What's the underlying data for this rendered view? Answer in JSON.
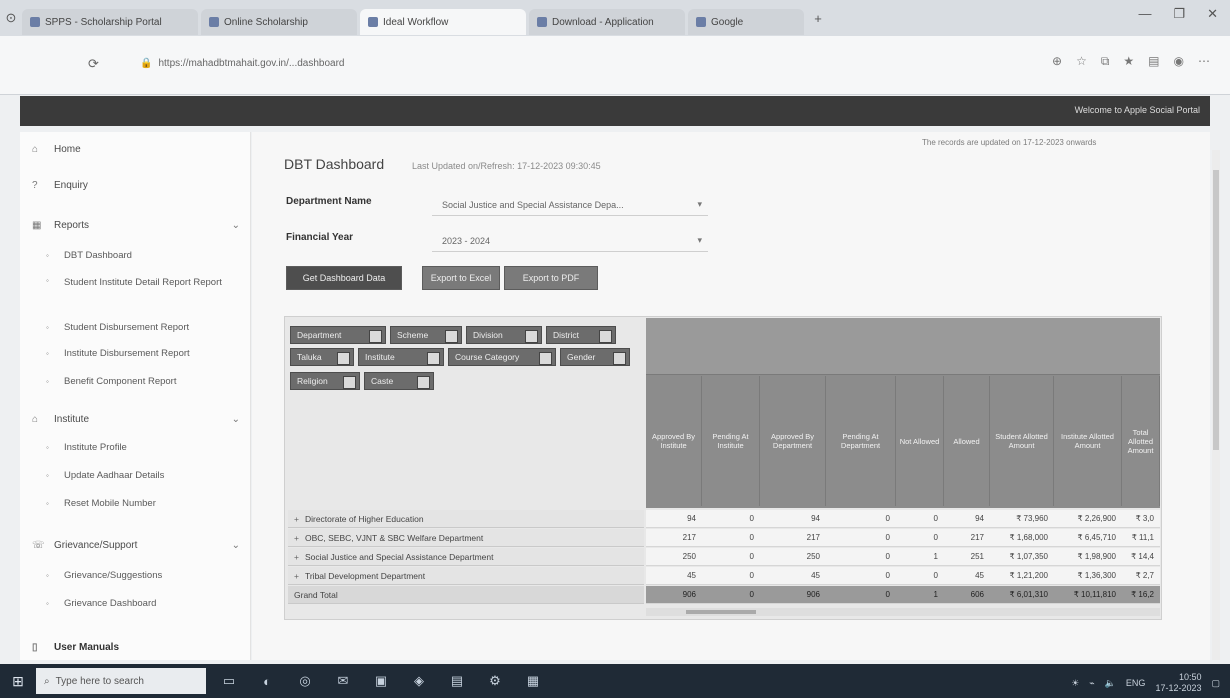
{
  "browser": {
    "tabs": [
      {
        "label": "SPPS - Scholarship Portal"
      },
      {
        "label": "Online Scholarship"
      },
      {
        "label": "Ideal Workflow"
      },
      {
        "label": "Download - Application"
      },
      {
        "label": "Google"
      }
    ],
    "active_tab_index": 2,
    "url": "https://mahadbtmahait.gov.in/...dashboard",
    "window_controls": [
      "—",
      "❐",
      "✕"
    ]
  },
  "appbar": {
    "welcome_text": "Welcome to Apple Social Portal"
  },
  "sidebar": {
    "items": [
      {
        "label": "Home",
        "icon": "home-icon",
        "level": 0
      },
      {
        "label": "Enquiry",
        "icon": "enquiry-icon",
        "level": 0
      },
      {
        "label": "Reports",
        "icon": "reports-icon",
        "level": 0,
        "caret": "⌄"
      },
      {
        "label": "DBT Dashboard",
        "icon": "bullet-icon",
        "level": 1
      },
      {
        "label": "Student Institute Detail Report Report",
        "icon": "bullet-icon",
        "level": 1
      },
      {
        "label": "Student Disbursement Report",
        "icon": "bullet-icon",
        "level": 1
      },
      {
        "label": "Institute Disbursement Report",
        "icon": "bullet-icon",
        "level": 1
      },
      {
        "label": "Benefit Component Report",
        "icon": "bullet-icon",
        "level": 1
      },
      {
        "label": "Institute",
        "icon": "institute-icon",
        "level": 0,
        "caret": "⌄"
      },
      {
        "label": "Institute Profile",
        "icon": "bullet-icon",
        "level": 1
      },
      {
        "label": "Update Aadhaar Details",
        "icon": "bullet-icon",
        "level": 1
      },
      {
        "label": "Reset Mobile Number",
        "icon": "bullet-icon",
        "level": 1
      },
      {
        "label": "Grievance/Support",
        "icon": "grievance-icon",
        "level": 0,
        "caret": "⌄"
      },
      {
        "label": "Grievance/Suggestions",
        "icon": "bullet-icon",
        "level": 1
      },
      {
        "label": "Grievance Dashboard",
        "icon": "bullet-icon",
        "level": 1
      },
      {
        "label": "User Manuals",
        "icon": "manual-icon",
        "level": 0
      }
    ]
  },
  "main": {
    "title": "DBT Dashboard",
    "title_sub": "Last Updated on/Refresh: 17-12-2023 09:30:45",
    "updated_note": "The records are updated on 17-12-2023 onwards",
    "department_label": "Department Name",
    "department_value": "Social Justice and Special Assistance Depa...",
    "year_label": "Financial Year",
    "year_value": "2023 - 2024",
    "buttons": {
      "get": "Get Dashboard Data",
      "excel": "Export to Excel",
      "pdf": "Export to PDF"
    }
  },
  "pivot": {
    "filter_chips": [
      "Department",
      "Scheme",
      "Division",
      "District",
      "Taluka",
      "Institute",
      "Course Category",
      "Gender",
      "Religion",
      "Caste"
    ],
    "columns": [
      "Approved By Institute",
      "Pending At Institute",
      "Approved By Department",
      "Pending At Department",
      "Not Allowed",
      "Allowed",
      "Student Allotted Amount",
      "Institute Allotted Amount",
      "Total Allotted Amount"
    ],
    "rows": [
      {
        "label": "Directorate of Higher Education",
        "values": [
          "94",
          "0",
          "94",
          "0",
          "0",
          "94",
          "₹ 73,960",
          "₹ 2,26,900",
          "₹ 3,0"
        ]
      },
      {
        "label": "OBC, SEBC, VJNT & SBC Welfare Department",
        "values": [
          "217",
          "0",
          "217",
          "0",
          "0",
          "217",
          "₹ 1,68,000",
          "₹ 6,45,710",
          "₹ 11,1"
        ]
      },
      {
        "label": "Social Justice and Special Assistance Department",
        "values": [
          "250",
          "0",
          "250",
          "0",
          "1",
          "251",
          "₹ 1,07,350",
          "₹ 1,98,900",
          "₹ 14,4"
        ]
      },
      {
        "label": "Tribal Development Department",
        "values": [
          "45",
          "0",
          "45",
          "0",
          "0",
          "45",
          "₹ 1,21,200",
          "₹ 1,36,300",
          "₹ 2,7"
        ]
      }
    ],
    "total": {
      "label": "Grand Total",
      "values": [
        "906",
        "0",
        "906",
        "0",
        "1",
        "606",
        "₹ 6,01,310",
        "₹ 10,11,810",
        "₹ 16,2"
      ]
    }
  },
  "taskbar": {
    "search_placeholder": "Type here to search",
    "tray_text": "ENG",
    "time": "10:50",
    "date": "17-12-2023"
  }
}
